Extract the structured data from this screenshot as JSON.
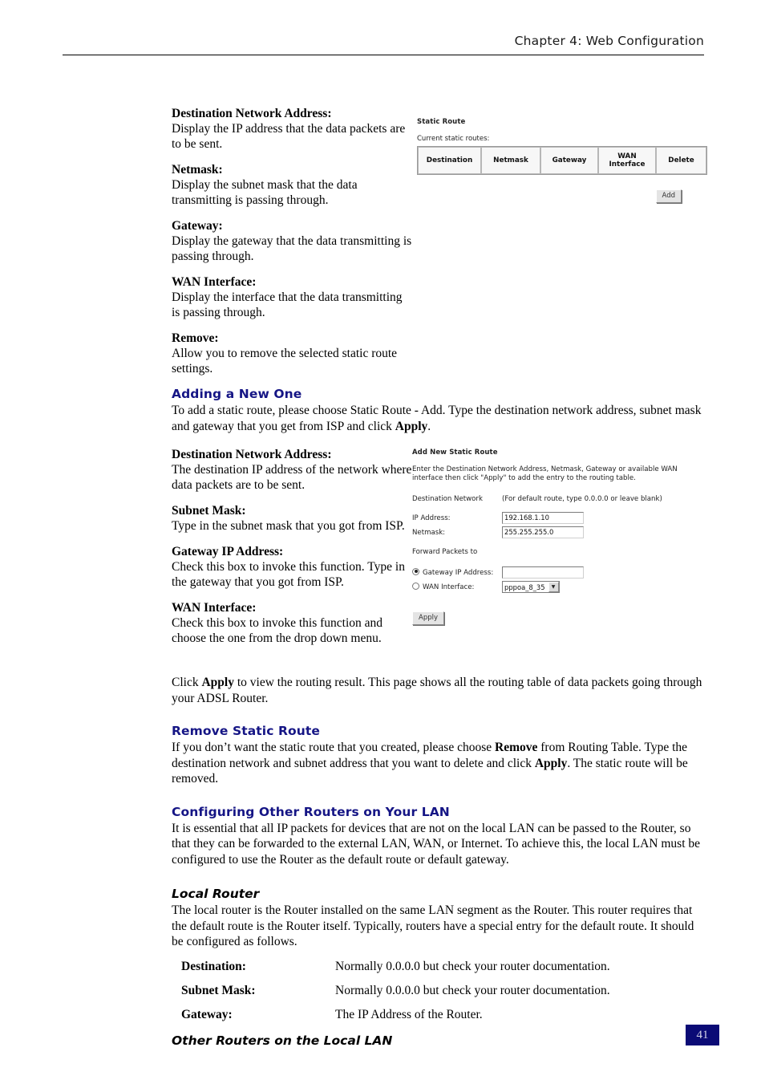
{
  "header": {
    "chapter_title": "Chapter 4: Web Configuration"
  },
  "page_number": "41",
  "definitions_top": [
    {
      "term": "Destination Network Address:",
      "desc": "Display the IP address that the data packets are to be sent."
    },
    {
      "term": "Netmask:",
      "desc": "Display the subnet mask that the data transmitting is passing through."
    },
    {
      "term": "Gateway:",
      "desc": "Display the gateway that the data transmitting is passing through."
    },
    {
      "term": "WAN Interface:",
      "desc": "Display the interface that the data transmitting is passing through."
    },
    {
      "term": "Remove:",
      "desc": "Allow you to remove the selected static route settings."
    }
  ],
  "static_route_shot": {
    "title": "Static Route",
    "subtitle": "Current static routes:",
    "columns": [
      "Destination",
      "Netmask",
      "Gateway",
      "WAN\nInterface",
      "Delete"
    ],
    "add_button": "Add"
  },
  "adding_new_one": {
    "heading": "Adding a New One",
    "body_1": "To add a static route, please choose Static Route - Add. Type the destination network address, subnet",
    "body_2_pre": "mask and gateway that you get from ISP and click ",
    "body_2_bold": "Apply",
    "body_2_post": "."
  },
  "definitions_add": [
    {
      "term": "Destination Network Address:",
      "desc": "The destination IP address of the network where data packets are to be sent."
    },
    {
      "term": "Subnet Mask:",
      "desc": "Type in the subnet mask that you got from ISP."
    },
    {
      "term": "Gateway IP Address:",
      "desc": "Check this box to invoke this function. Type in the gateway that you got from ISP."
    },
    {
      "term": "WAN Interface:",
      "desc": "Check this box to invoke this function and choose the one from the drop down menu."
    }
  ],
  "add_route_shot": {
    "title": "Add New Static Route",
    "instructions_line1": "Enter the Destination Network Address, Netmask, Gateway or available WAN",
    "instructions_line2": "interface then click \"Apply\" to add the entry to the routing table.",
    "destination_network_label": "Destination Network",
    "destination_network_note": "(For default route, type 0.0.0.0 or leave blank)",
    "ip_address_label": "IP Address:",
    "ip_address_value": "192.168.1.10",
    "netmask_label": "Netmask:",
    "netmask_value": "255.255.255.0",
    "forward_label": "Forward Packets to",
    "gateway_radio_label": "Gateway IP Address:",
    "gateway_value": "",
    "wan_radio_label": "WAN Interface:",
    "wan_selected": "pppoa_8_35",
    "apply_button": "Apply"
  },
  "apply_para": {
    "pre": "Click ",
    "bold": "Apply",
    "post": " to view the routing result. This page shows all the routing table of data packets going through your ADSL Router."
  },
  "remove_static_route": {
    "heading": "Remove Static Route",
    "seg1": "If you don’t want the static route that you created, please choose ",
    "bold1": "Remove",
    "seg2": " from Routing Table. Type the destination network and subnet address that you want to delete and click ",
    "bold2": "Apply",
    "seg3": ". The static route will be removed."
  },
  "configuring_other_routers": {
    "heading": "Configuring Other Routers on Your LAN",
    "body": "It is essential that all IP packets for devices that are not on the local LAN can be passed to the Router, so that they can be forwarded to the external LAN, WAN, or Internet. To achieve this, the local LAN must be configured to use the Router as the default route or default gateway."
  },
  "local_router": {
    "heading": "Local Router",
    "body": "The local router is the Router installed on the same LAN segment as the Router. This router requires that the default route is the Router itself. Typically, routers have a special entry for the default route. It should be configured as follows.",
    "settings": [
      {
        "key": "Destination:",
        "value": "Normally 0.0.0.0 but check your router documentation."
      },
      {
        "key": "Subnet Mask:",
        "value": "Normally 0.0.0.0 but check your router documentation."
      },
      {
        "key": "Gateway:",
        "value": "The IP Address of the Router."
      }
    ]
  },
  "other_routers": {
    "heading": "Other Routers on the Local LAN"
  }
}
